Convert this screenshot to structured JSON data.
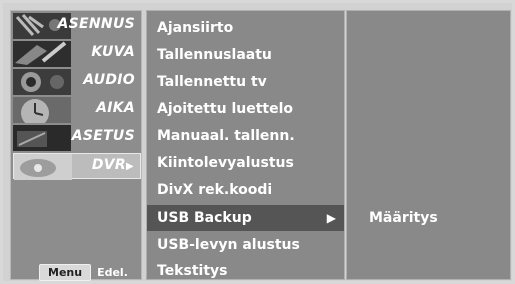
{
  "sidebar": {
    "categories": [
      {
        "label": "ASENNUS",
        "icon": "setup-icon"
      },
      {
        "label": "KUVA",
        "icon": "picture-icon"
      },
      {
        "label": "AUDIO",
        "icon": "audio-icon"
      },
      {
        "label": "AIKA",
        "icon": "time-icon"
      },
      {
        "label": "ASETUS",
        "icon": "option-icon"
      },
      {
        "label": "DVR",
        "icon": "dvr-icon",
        "arrow": "▶"
      }
    ],
    "menu_key": "Menu",
    "menu_back": "Edel."
  },
  "menu": {
    "items": [
      {
        "label": "Ajansiirto"
      },
      {
        "label": "Tallennuslaatu"
      },
      {
        "label": "Tallennettu tv"
      },
      {
        "label": "Ajoitettu luettelo"
      },
      {
        "label": "Manuaal. tallenn."
      },
      {
        "label": "Kiintolevyalustus"
      },
      {
        "label": "DivX rek.koodi"
      },
      {
        "label": "USB Backup",
        "arrow": "▶"
      },
      {
        "label": "USB-levyn alustus"
      },
      {
        "label": "Tekstitys"
      }
    ]
  },
  "submenu": {
    "label": "Määritys"
  },
  "colors": {
    "panel_bg": "#898989",
    "selected_bg": "#555555",
    "text": "#ffffff"
  }
}
